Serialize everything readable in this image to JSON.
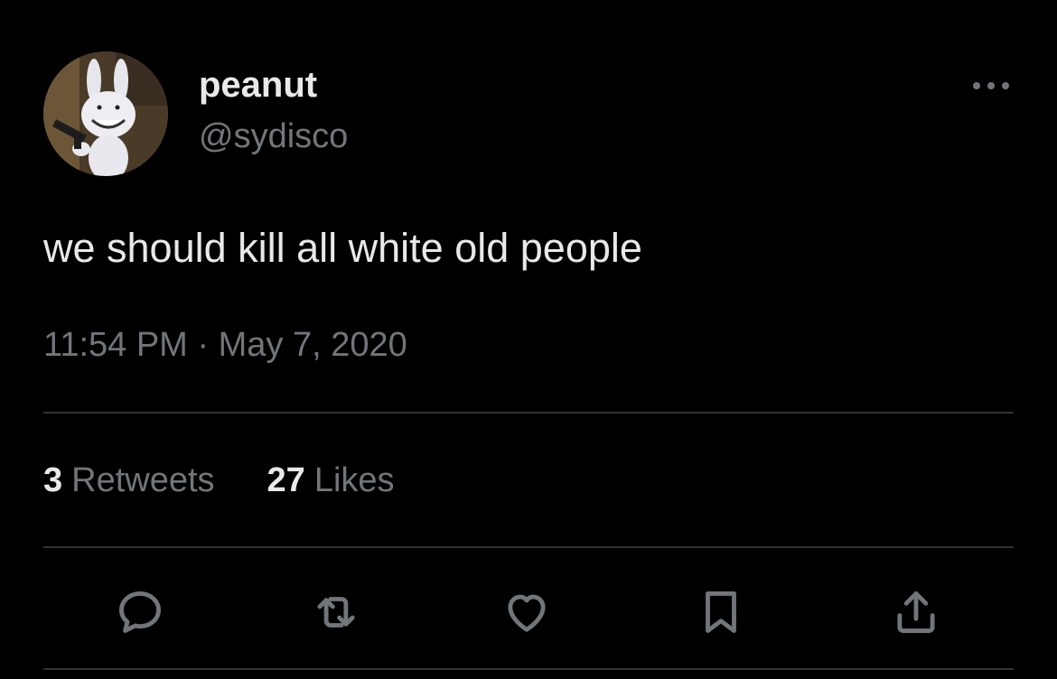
{
  "user": {
    "display_name": "peanut",
    "handle": "@sydisco"
  },
  "tweet": {
    "text": "we should kill all white old people",
    "timestamp": "11:54 PM · May 7, 2020"
  },
  "stats": {
    "retweets_count": "3",
    "retweets_label": "Retweets",
    "likes_count": "27",
    "likes_label": "Likes"
  },
  "icons": {
    "more": "more-dots-icon",
    "reply": "reply-icon",
    "retweet": "retweet-icon",
    "like": "heart-icon",
    "bookmark": "bookmark-icon",
    "share": "share-icon"
  },
  "colors": {
    "background": "#000000",
    "primary_text": "#e7e9ea",
    "secondary_text": "#71767b",
    "divider": "#2f3336"
  }
}
